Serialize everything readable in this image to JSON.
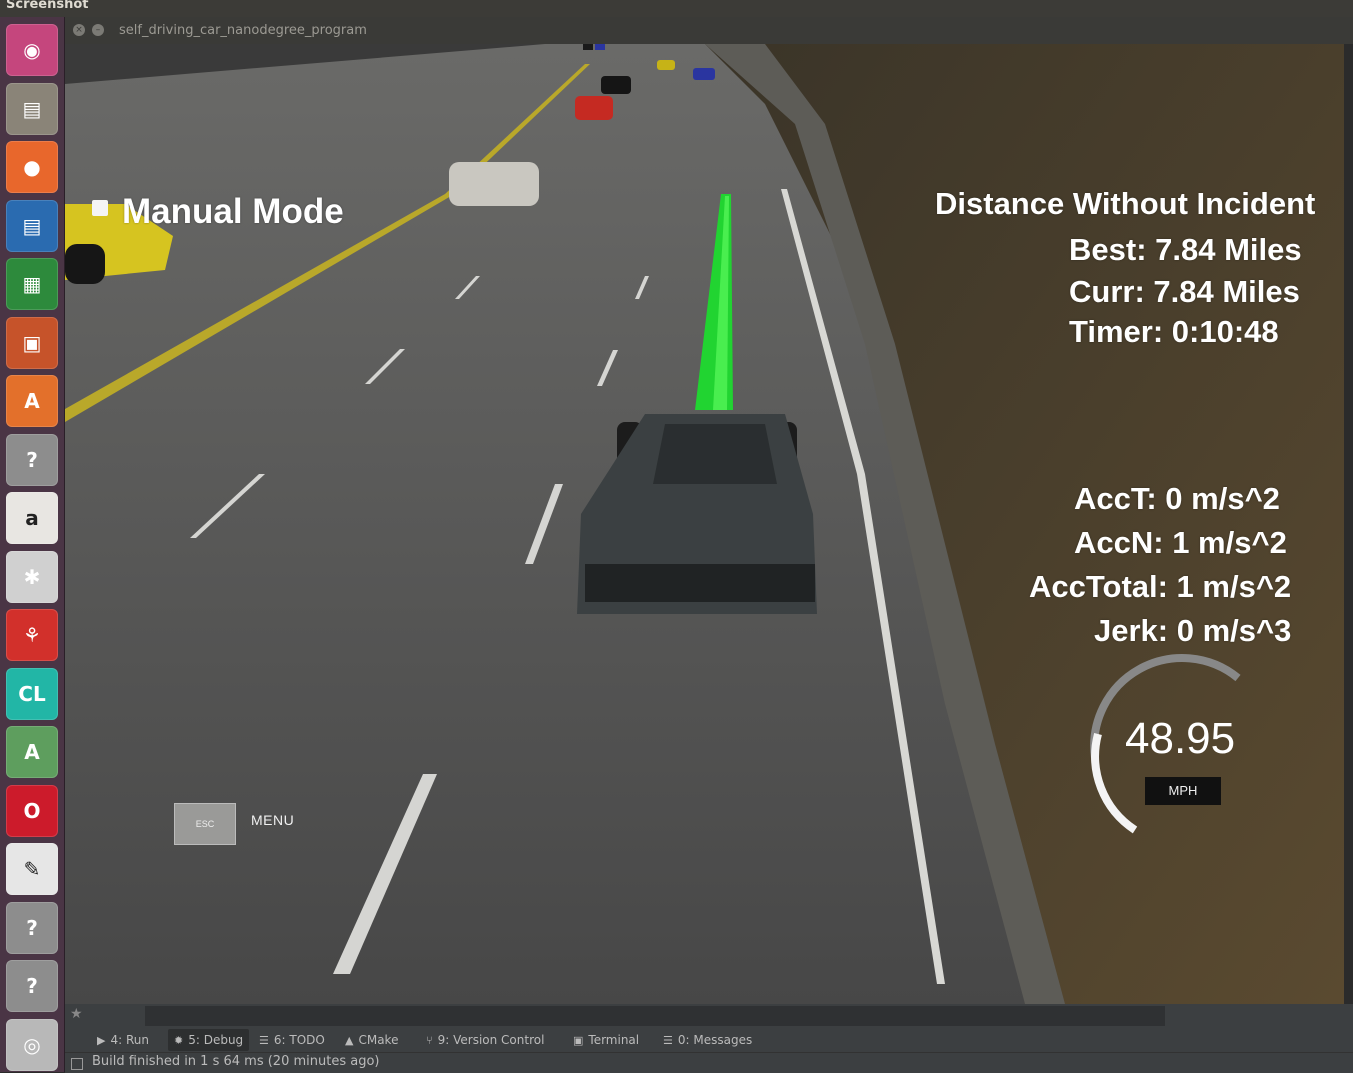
{
  "top_panel": {
    "title": "Screenshot"
  },
  "window": {
    "title": "self_driving_car_nanodegree_program",
    "close_glyph": "×",
    "minimize_glyph": "–"
  },
  "launcher": [
    {
      "name": "ubuntu-dash-icon",
      "glyph": "◉",
      "bg": "#c5467d"
    },
    {
      "name": "files-icon",
      "glyph": "▤",
      "bg": "#8a8478"
    },
    {
      "name": "firefox-icon",
      "glyph": "●",
      "bg": "#e8672c"
    },
    {
      "name": "writer-icon",
      "glyph": "▤",
      "bg": "#2a6bb0"
    },
    {
      "name": "calc-icon",
      "glyph": "▦",
      "bg": "#2d8a3c"
    },
    {
      "name": "impress-icon",
      "glyph": "▣",
      "bg": "#c6532a"
    },
    {
      "name": "software-center-icon",
      "glyph": "A",
      "bg": "#e3702b"
    },
    {
      "name": "unknown-app-icon",
      "glyph": "?",
      "bg": "#8d8d8d"
    },
    {
      "name": "amazon-icon",
      "glyph": "a",
      "bg": "#e8e6e2"
    },
    {
      "name": "system-settings-icon",
      "glyph": "✱",
      "bg": "#d0d0d0"
    },
    {
      "name": "app-red-icon",
      "glyph": "⚘",
      "bg": "#d2302b"
    },
    {
      "name": "clion-icon",
      "glyph": "CL",
      "bg": "#22b6a6"
    },
    {
      "name": "software-updater-icon",
      "glyph": "A",
      "bg": "#5e9e5e"
    },
    {
      "name": "opera-icon",
      "glyph": "O",
      "bg": "#cc1b2b"
    },
    {
      "name": "text-editor-icon",
      "glyph": "✎",
      "bg": "#e6e6e6"
    },
    {
      "name": "unknown-app-icon-2",
      "glyph": "?",
      "bg": "#8d8d8d"
    },
    {
      "name": "unknown-app-icon-3",
      "glyph": "?",
      "bg": "#8d8d8d"
    },
    {
      "name": "screenshot-camera-icon",
      "glyph": "◎",
      "bg": "#b8b8b8"
    }
  ],
  "hud": {
    "mode": "Manual Mode",
    "distance_title": "Distance Without Incident",
    "best": "Best: 7.84 Miles",
    "curr": "Curr: 7.84 Miles",
    "timer": "Timer: 0:10:48",
    "acc_t": "AccT: 0 m/s^2",
    "acc_n": "AccN: 1 m/s^2",
    "acc_total": "AccTotal: 1 m/s^2",
    "jerk": "Jerk: 0 m/s^3",
    "esc_label": "ESC",
    "menu_label": "MENU",
    "speed": "48.95",
    "speed_unit": "MPH"
  },
  "ide": {
    "star_glyph": "★",
    "tabs": [
      {
        "label": "4: Run",
        "icon": "▶"
      },
      {
        "label": "5: Debug",
        "icon": "✹"
      },
      {
        "label": "6: TODO",
        "icon": "☰"
      },
      {
        "label": "CMake",
        "icon": "▲"
      },
      {
        "label": "9: Version Control",
        "icon": "⑂"
      },
      {
        "label": "Terminal",
        "icon": "▣"
      },
      {
        "label": "0: Messages",
        "icon": "☰"
      }
    ],
    "status": "Build finished in 1 s 64 ms (20 minutes ago)"
  }
}
